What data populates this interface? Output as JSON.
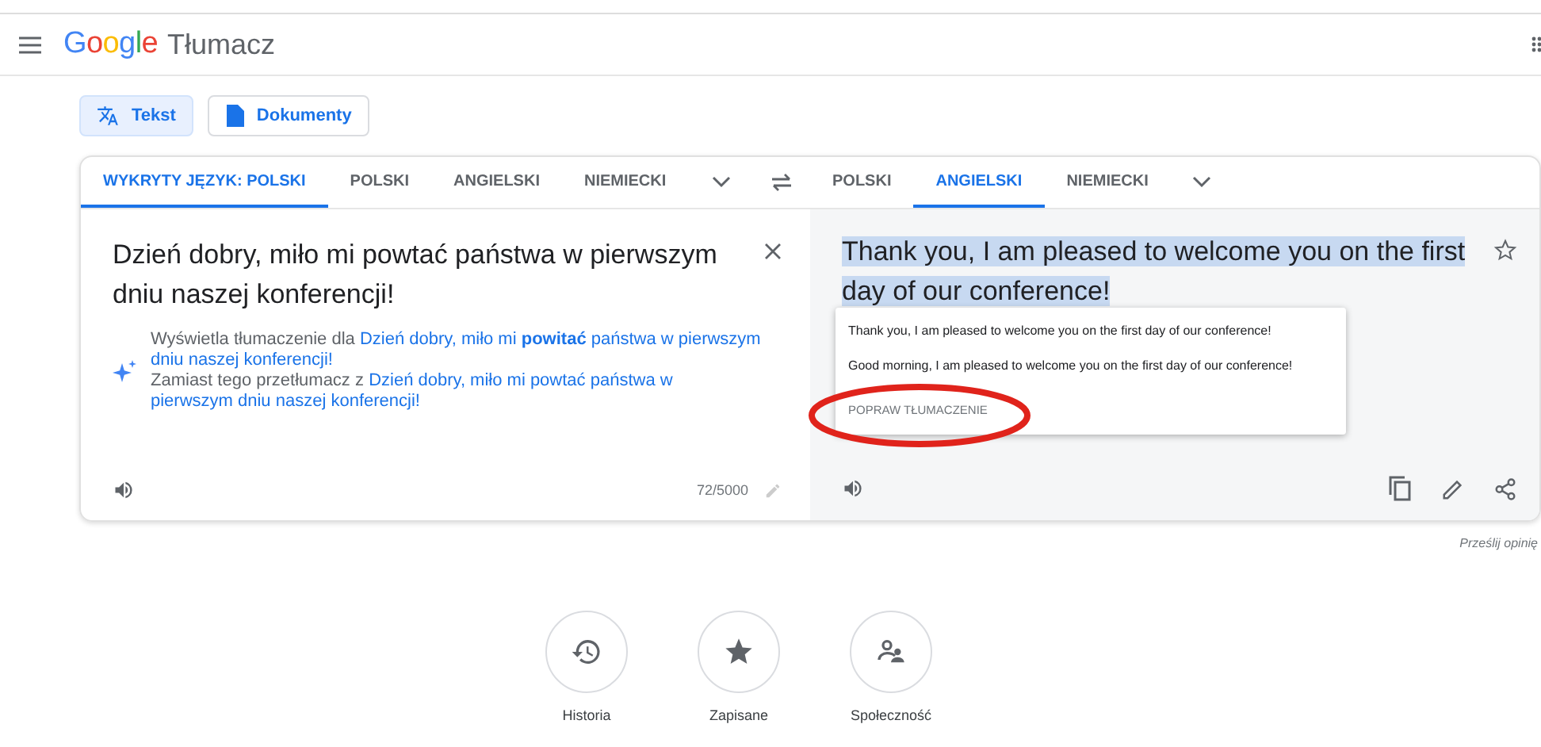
{
  "header": {
    "logo": "Google",
    "product": "Tłumacz"
  },
  "modes": [
    {
      "label": "Tekst",
      "selected": true,
      "kind": "text"
    },
    {
      "label": "Dokumenty",
      "selected": false,
      "kind": "docs"
    }
  ],
  "source_tabs": [
    {
      "label": "WYKRYTY JĘZYK: POLSKI",
      "selected": true
    },
    {
      "label": "POLSKI",
      "selected": false
    },
    {
      "label": "ANGIELSKI",
      "selected": false
    },
    {
      "label": "NIEMIECKI",
      "selected": false
    }
  ],
  "target_tabs": [
    {
      "label": "POLSKI",
      "selected": false
    },
    {
      "label": "ANGIELSKI",
      "selected": true
    },
    {
      "label": "NIEMIECKI",
      "selected": false
    }
  ],
  "source": {
    "text": "Dzień dobry, miło mi powtać państwa w pierwszym dniu naszej konferencji!",
    "counter": "72/5000"
  },
  "suggestions": [
    {
      "prefix": "Wyświetla tłumaczenie dla",
      "link_lines": [
        "Dzień dobry, miło mi **powitać** państwa w pierwszym",
        "dniu naszej konferencji!"
      ]
    },
    {
      "prefix": "Zamiast tego przetłumacz z",
      "link_lines": [
        "Dzień dobry, miło mi powtać państwa w",
        "pierwszym dniu naszej konferencji!"
      ]
    }
  ],
  "target": {
    "text": "Thank you, I am pleased to welcome you on the first day of our conference!",
    "highlighted": true
  },
  "alternatives": {
    "options": [
      "Thank you, I am pleased to welcome you on the first day of our conference!",
      "Good morning, I am pleased to welcome you on the first day of our conference!"
    ],
    "action": "POPRAW TŁUMACZENIE",
    "circled": true
  },
  "feedback": "Prześlij opinię",
  "shortcuts": [
    {
      "label": "Historia",
      "kind": "history"
    },
    {
      "label": "Zapisane",
      "kind": "saved"
    },
    {
      "label": "Społeczność",
      "kind": "community"
    }
  ]
}
